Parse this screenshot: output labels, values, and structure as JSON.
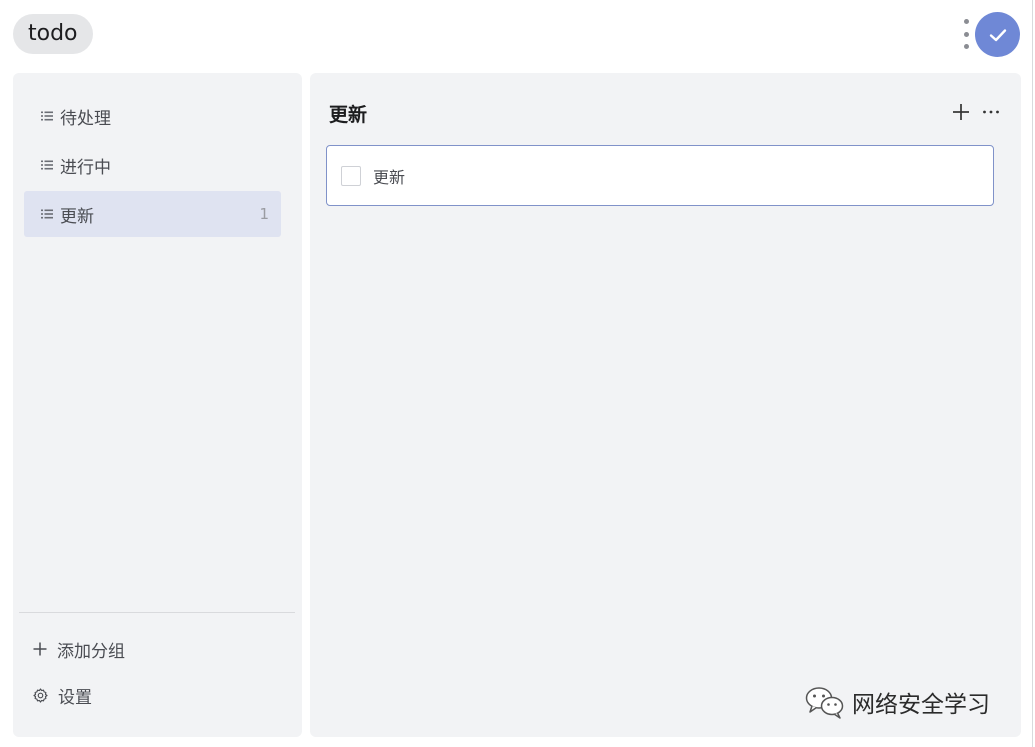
{
  "header": {
    "app_title": "todo",
    "accent": "#6f88d6"
  },
  "sidebar": {
    "groups": [
      {
        "label": "待处理",
        "count": ""
      },
      {
        "label": "进行中",
        "count": ""
      },
      {
        "label": "更新",
        "count": "1",
        "active": true
      }
    ],
    "add_group_label": "添加分组",
    "settings_label": "设置"
  },
  "main": {
    "title": "更新",
    "tasks": [
      {
        "label": "更新",
        "checked": false
      }
    ]
  },
  "watermark": {
    "text": "网络安全学习"
  }
}
